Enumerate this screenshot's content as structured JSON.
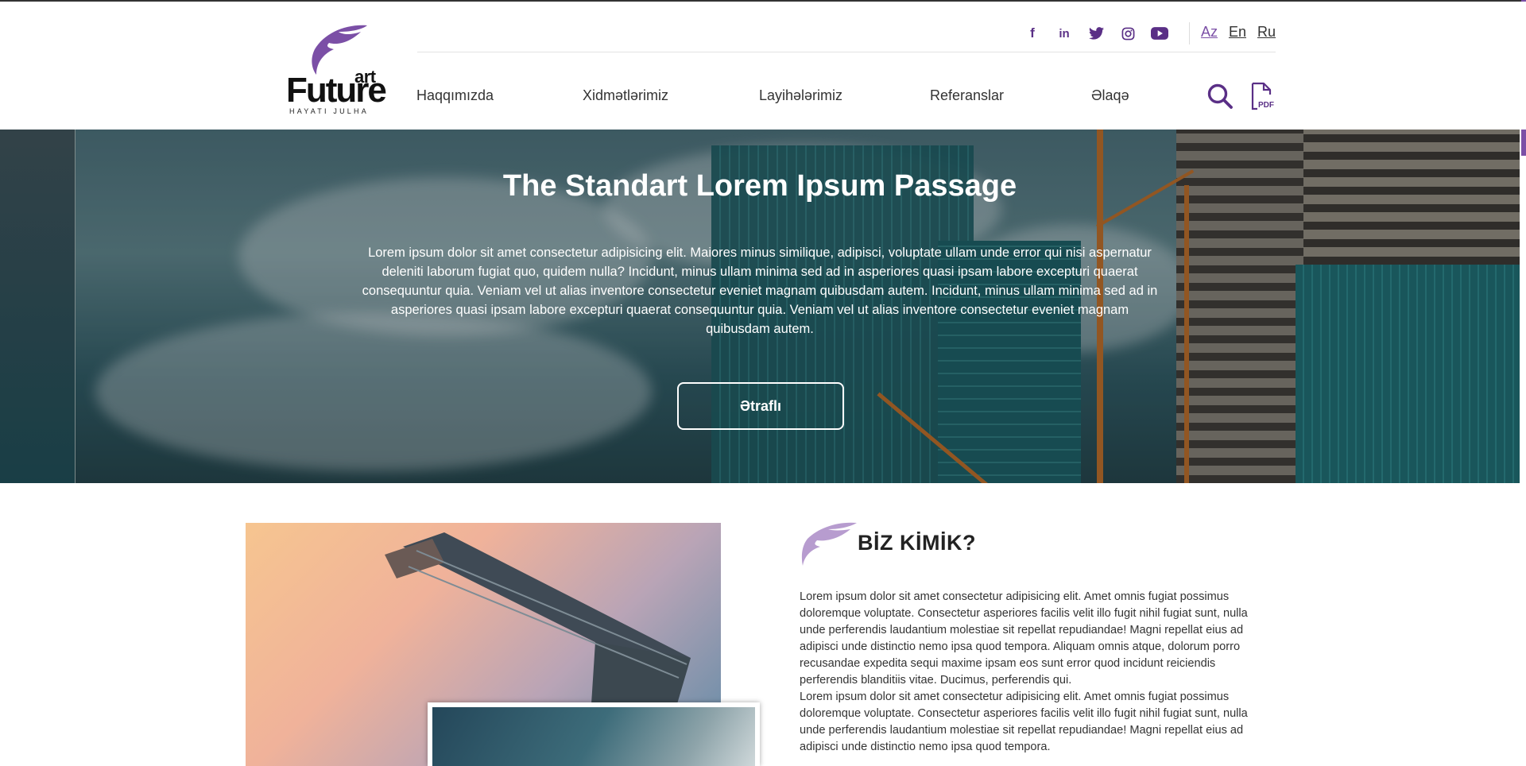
{
  "brand": {
    "art": "art",
    "name": "Future",
    "subtitle": "HAYATI JULHA"
  },
  "socials": [
    {
      "icon": "facebook-icon",
      "glyph": "f"
    },
    {
      "icon": "linkedin-icon",
      "glyph": "in"
    },
    {
      "icon": "twitter-icon",
      "glyph": "t"
    },
    {
      "icon": "instagram-icon",
      "glyph": "◎"
    },
    {
      "icon": "youtube-icon",
      "glyph": "▶"
    }
  ],
  "languages": [
    "Az",
    "En",
    "Ru"
  ],
  "active_language": "Az",
  "nav": [
    "Haqqımızda",
    "Xidmətlərimiz",
    "Layihələrimiz",
    "Referanslar",
    "Əlaqə"
  ],
  "pdf_label": "PDF",
  "hero": {
    "title": "The Standart Lorem Ipsum Passage",
    "text": "Lorem ipsum dolor sit amet consectetur adipisicing elit. Maiores minus similique, adipisci, voluptate ullam unde error qui nisi aspernatur deleniti laborum fugiat quo, quidem nulla? Incidunt, minus ullam minima sed ad in asperiores quasi ipsam labore excepturi quaerat consequuntur quia. Veniam vel ut alias inventore consectetur eveniet magnam quibusdam autem. Incidunt, minus ullam minima sed ad in asperiores quasi ipsam labore excepturi quaerat consequuntur quia. Veniam vel ut alias inventore consectetur eveniet magnam quibusdam autem.",
    "button": "Ətraflı"
  },
  "about": {
    "title": "BİZ KİMİK?",
    "paragraph1": "Lorem ipsum dolor sit amet consectetur adipisicing elit. Amet omnis fugiat possimus doloremque voluptate. Consectetur asperiores facilis velit illo fugit nihil fugiat sunt, nulla unde perferendis laudantium molestiae sit repellat repudiandae! Magni repellat eius ad adipisci unde distinctio nemo ipsa quod tempora. Aliquam omnis atque, dolorum porro recusandae expedita sequi maxime ipsam eos sunt error quod incidunt reiciendis perferendis blanditiis vitae. Ducimus, perferendis qui.",
    "paragraph2": "Lorem ipsum dolor sit amet consectetur adipisicing elit. Amet omnis fugiat possimus doloremque voluptate. Consectetur asperiores facilis velit illo fugit nihil fugiat sunt, nulla unde perferendis laudantium molestiae sit repellat repudiandae! Magni repellat eius ad adipisci unde distinctio nemo ipsa quod tempora."
  },
  "colors": {
    "accent": "#7b4fa6",
    "icon": "#5a2f86"
  }
}
